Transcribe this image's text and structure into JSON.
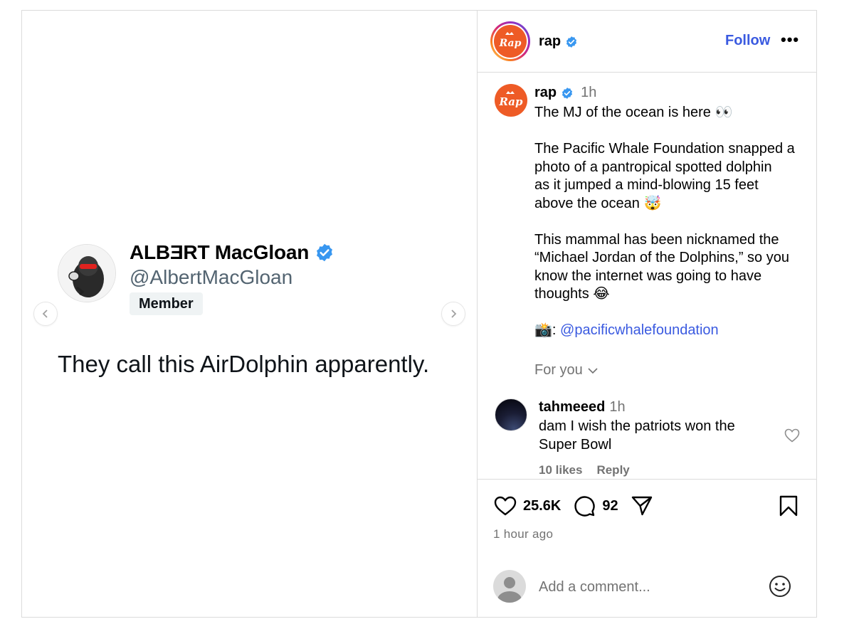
{
  "media": {
    "tweet": {
      "name": "ALBƎRT MacGloan",
      "handle": "@AlbertMacGloan",
      "badge": "Member",
      "text": "They call this AirDolphin apparently."
    },
    "nav_prev_icon": "chevron-left-icon",
    "nav_next_icon": "chevron-right-icon"
  },
  "header": {
    "username": "rap",
    "follow_label": "Follow",
    "more_label": "•••"
  },
  "caption": {
    "username": "rap",
    "time": "1h",
    "lines": [
      "The MJ of the ocean is here 👀",
      "",
      "The Pacific Whale Foundation snapped a",
      "photo of a pantropical spotted dolphin",
      "as it jumped a mind-blowing 15 feet",
      "above the ocean 🤯",
      "",
      "This mammal has been nicknamed the",
      "“Michael Jordan of the Dolphins,” so you",
      "know the internet was going to have",
      "thoughts 😂",
      ""
    ],
    "credit_prefix": "📸: ",
    "credit_mention": "@pacificwhalefoundation",
    "for_you": "For you"
  },
  "comment": {
    "username": "tahmeeed",
    "time": "1h",
    "text": "dam I wish the patriots won the Super Bowl",
    "likes": "10 likes",
    "reply": "Reply"
  },
  "actions": {
    "likes_count": "25.6K",
    "comments_count": "92",
    "time_ago": "1 hour ago"
  },
  "add_comment": {
    "placeholder": "Add a comment..."
  },
  "colors": {
    "verified": "#3897f0",
    "link": "#3a5ae0",
    "brand_orange": "#ee5b26",
    "muted": "#737373"
  }
}
